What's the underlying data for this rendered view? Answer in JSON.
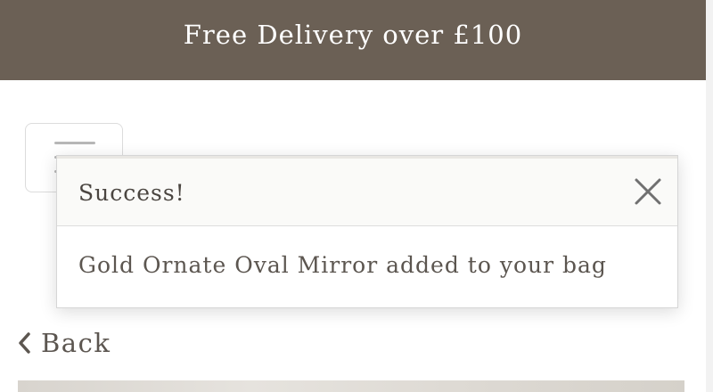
{
  "promo": {
    "text": "Free Delivery over £100"
  },
  "header": {
    "menu_icon": "hamburger-menu-icon"
  },
  "toast": {
    "title": "Success!",
    "message": "Gold Ornate Oval Mirror added to your bag",
    "close_icon": "close-icon"
  },
  "nav": {
    "back_label": "Back",
    "back_icon": "chevron-left-icon"
  },
  "colors": {
    "promo_background": "#6b6055",
    "text_primary": "#5c5650",
    "toast_header_background": "#fafaf8"
  }
}
